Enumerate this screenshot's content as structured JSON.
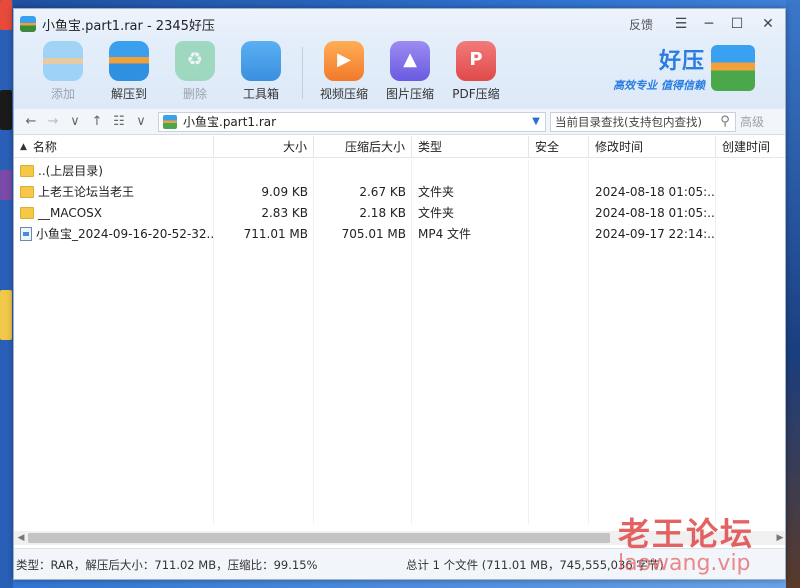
{
  "window": {
    "title": "小鱼宝.part1.rar - 2345好压",
    "feedback": "反馈",
    "controls": {
      "menu": "☰",
      "minimize": "─",
      "maximize": "☐",
      "close": "✕"
    }
  },
  "toolbar": {
    "tools": [
      {
        "label": "添加",
        "icon": "add-archive-icon",
        "enabled": false
      },
      {
        "label": "解压到",
        "icon": "extract-icon",
        "enabled": true
      },
      {
        "label": "删除",
        "icon": "recycle-icon",
        "enabled": false
      },
      {
        "label": "工具箱",
        "icon": "toolbox-icon",
        "enabled": true
      },
      {
        "label": "视频压缩",
        "icon": "video-icon",
        "enabled": true
      },
      {
        "label": "图片压缩",
        "icon": "image-icon",
        "enabled": true
      },
      {
        "label": "PDF压缩",
        "icon": "pdf-icon",
        "enabled": true
      }
    ]
  },
  "brand": {
    "name": "好压",
    "slogan": "高效专业  值得信赖"
  },
  "nav": {
    "path": "小鱼宝.part1.rar",
    "search_placeholder": "当前目录查找(支持包内查找)",
    "advanced": "高级"
  },
  "table": {
    "columns": [
      {
        "label": "名称",
        "sorted": true
      },
      {
        "label": "大小"
      },
      {
        "label": "压缩后大小"
      },
      {
        "label": "类型"
      },
      {
        "label": "安全"
      },
      {
        "label": "修改时间"
      },
      {
        "label": "创建时间"
      }
    ],
    "rows": [
      {
        "name": "..(上层目录)",
        "icon": "folder-icon",
        "size": "",
        "csize": "",
        "type": "",
        "sec": "",
        "mtime": "",
        "ctime": ""
      },
      {
        "name": "上老王论坛当老王",
        "icon": "folder-icon",
        "size": "9.09 KB",
        "csize": "2.67 KB",
        "type": "文件夹",
        "sec": "",
        "mtime": "2024-08-18 01:05:...",
        "ctime": ""
      },
      {
        "name": "__MACOSX",
        "icon": "folder-icon",
        "size": "2.83 KB",
        "csize": "2.18 KB",
        "type": "文件夹",
        "sec": "",
        "mtime": "2024-08-18 01:05:...",
        "ctime": ""
      },
      {
        "name": "小鱼宝_2024-09-16-20-52-32...",
        "icon": "video-file-icon",
        "size": "711.01 MB",
        "csize": "705.01 MB",
        "type": "MP4 文件",
        "sec": "",
        "mtime": "2024-09-17 22:14:...",
        "ctime": ""
      }
    ]
  },
  "status": {
    "left": "类型：RAR，解压后大小：711.02 MB，压缩比：99.15%",
    "right": "总计 1 个文件 (711.01 MB，745,555,036 字节)"
  },
  "watermark": {
    "text": "老王论坛",
    "url": "laowang.vip"
  }
}
